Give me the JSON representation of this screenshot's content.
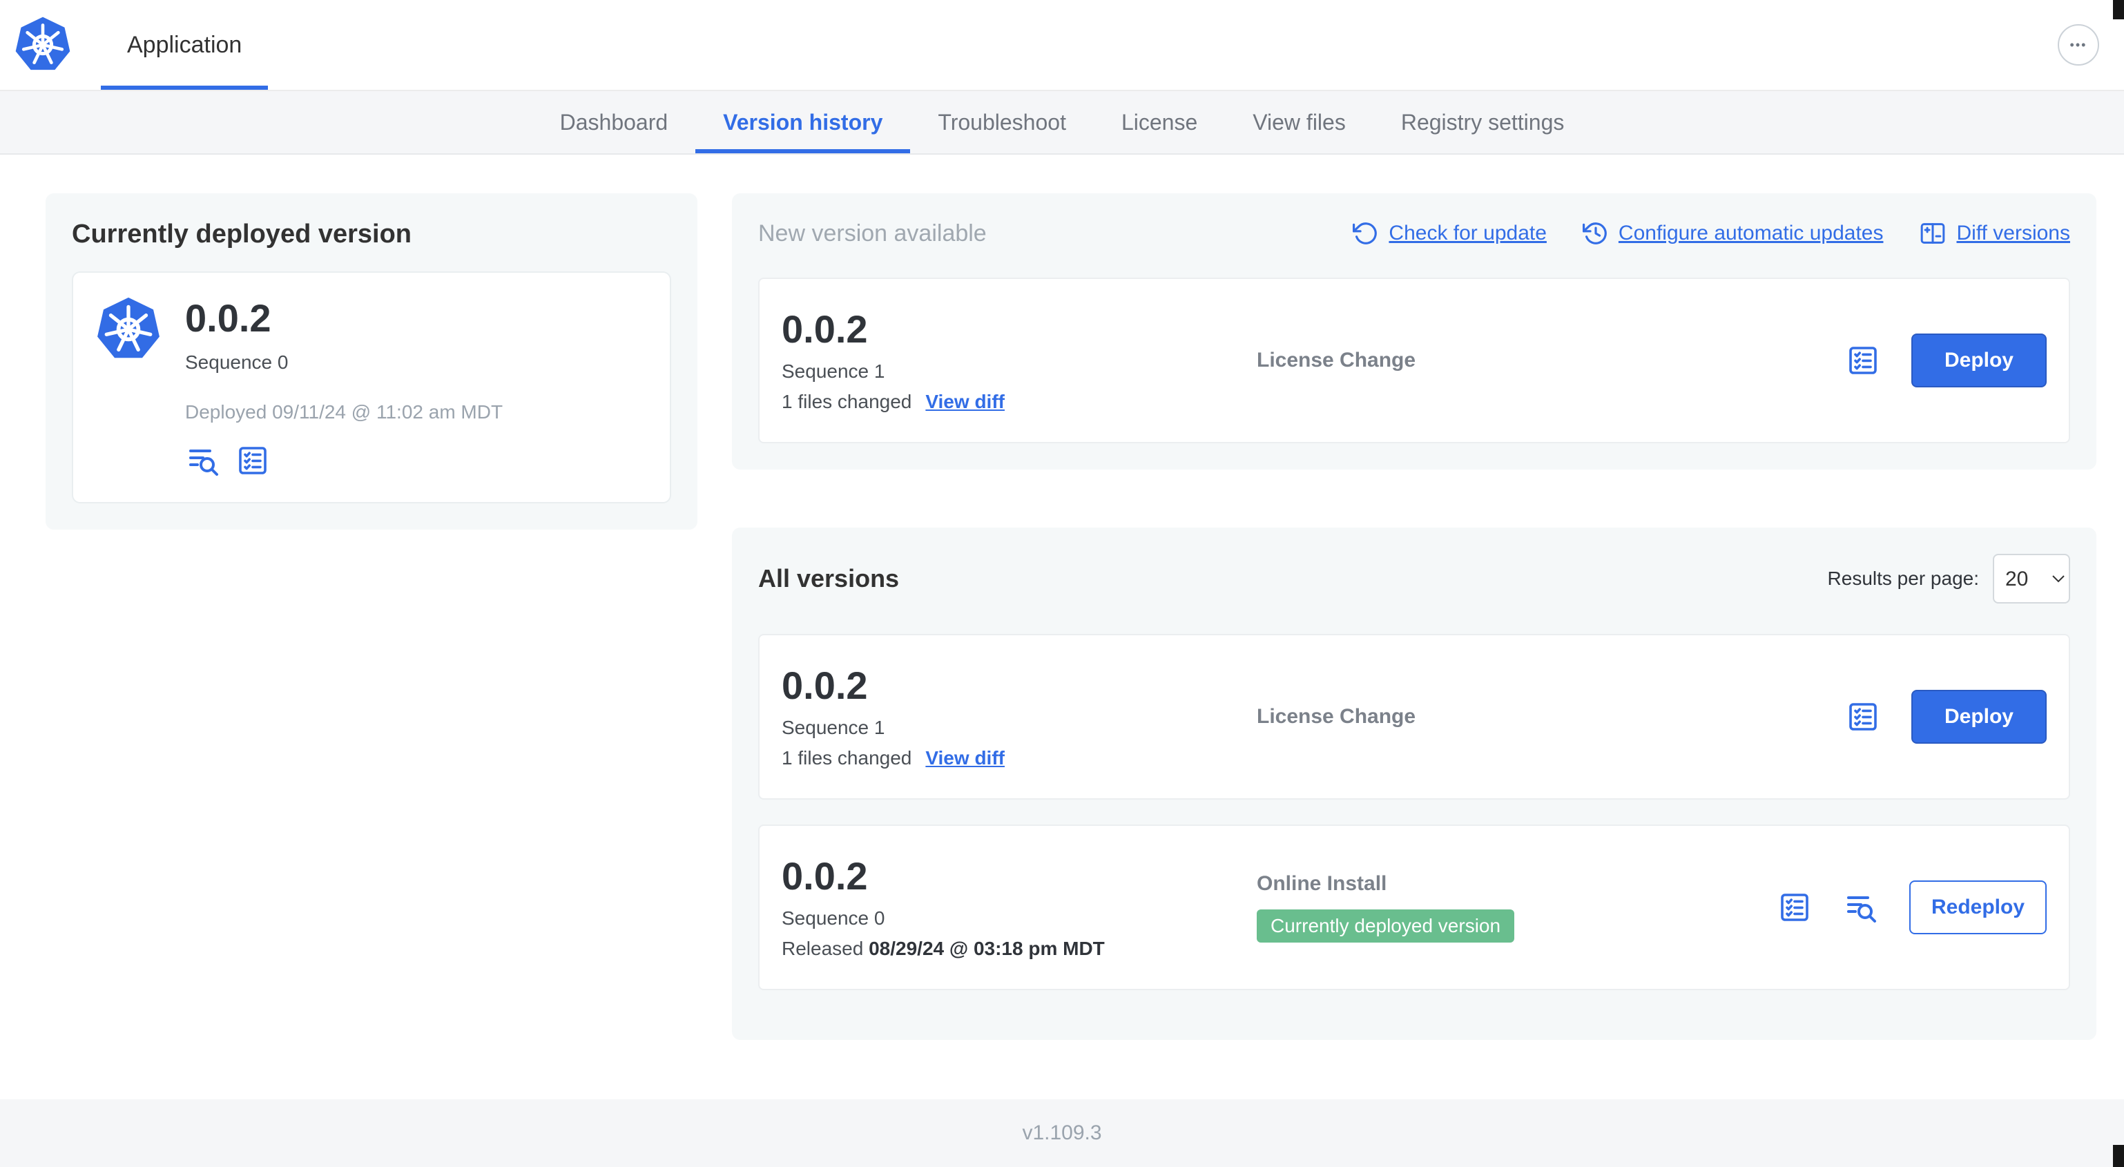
{
  "header": {
    "app_tab_label": "Application",
    "more_options_glyph": "•••"
  },
  "nav": {
    "tabs": [
      {
        "label": "Dashboard",
        "active": false
      },
      {
        "label": "Version history",
        "active": true
      },
      {
        "label": "Troubleshoot",
        "active": false
      },
      {
        "label": "License",
        "active": false
      },
      {
        "label": "View files",
        "active": false
      },
      {
        "label": "Registry settings",
        "active": false
      }
    ]
  },
  "currently_deployed": {
    "title": "Currently deployed version",
    "version": "0.0.2",
    "sequence": "Sequence 0",
    "deployed_at": "Deployed 09/11/24 @ 11:02 am MDT"
  },
  "new_version": {
    "title": "New version available",
    "check_for_update": "Check for update",
    "configure_automatic_updates": "Configure automatic updates",
    "diff_versions": "Diff versions",
    "release": {
      "version": "0.0.2",
      "sequence": "Sequence 1",
      "files_changed": "1 files changed",
      "view_diff": "View diff",
      "notes": "License Change",
      "action": "Deploy"
    }
  },
  "all_versions": {
    "title": "All versions",
    "results_per_page_label": "Results per page:",
    "results_per_page": "20",
    "rows": [
      {
        "version": "0.0.2",
        "sequence": "Sequence 1",
        "files_changed": "1 files changed",
        "view_diff": "View diff",
        "notes": "License Change",
        "action": "Deploy"
      },
      {
        "version": "0.0.2",
        "sequence": "Sequence 0",
        "released_label": "Released",
        "released_at": "08/29/24 @ 03:18 pm MDT",
        "notes": "Online Install",
        "badge": "Currently deployed version",
        "action": "Redeploy"
      }
    ]
  },
  "footer": {
    "app_version": "v1.109.3"
  },
  "icons": {
    "logo": "kubernetes-logo",
    "more_options": "ellipsis-icon",
    "check_for_update": "rotate-ccw-icon",
    "configure_automatic_updates": "clock-history-icon",
    "diff_versions": "diff-table-icon",
    "preflight_checks": "checklist-icon",
    "view_logs": "logs-search-icon"
  },
  "colors": {
    "accent": "#326de6",
    "badge_green": "#69be8e",
    "card_bg": "#f5f8f9",
    "muted": "#9aa3ad"
  }
}
